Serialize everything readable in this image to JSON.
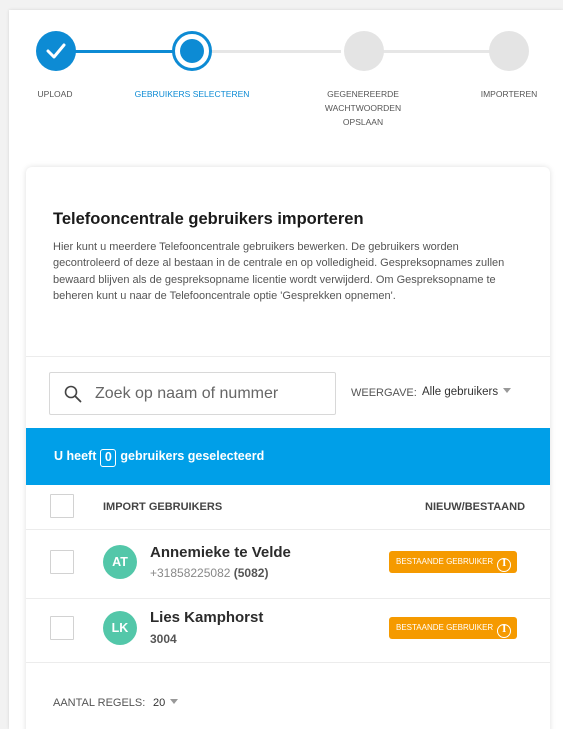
{
  "stepper": {
    "steps": [
      {
        "label": "UPLOAD",
        "state": "done"
      },
      {
        "label": "GEBRUIKERS SELECTEREN",
        "state": "current"
      },
      {
        "label": "GEGENEREERDE WACHTWOORDEN OPSLAAN",
        "state": "pending"
      },
      {
        "label": "IMPORTEREN",
        "state": "pending"
      }
    ]
  },
  "card": {
    "title": "Telefooncentrale gebruikers importeren",
    "description": "Hier kunt u meerdere Telefooncentrale gebruikers bewerken. De gebruikers worden gecontroleerd of deze al bestaan in de centrale en op volledigheid. Gespreksopnames zullen bewaard blijven als de gespreksopname licentie wordt verwijderd. Om Gespreksopname te beheren kunt u naar de Telefooncentrale optie 'Gesprekken opnemen'."
  },
  "search": {
    "placeholder": "Zoek op naam of nummer",
    "value": ""
  },
  "view": {
    "label": "WEERGAVE:",
    "value": "Alle gebruikers"
  },
  "selection": {
    "prefix": "U heeft",
    "count": "0",
    "suffix": "gebruikers geselecteerd"
  },
  "table": {
    "col_import": "IMPORT GEBRUIKERS",
    "col_status": "NIEUW/BESTAAND",
    "rows": [
      {
        "initials": "AT",
        "name": "Annemieke te Velde",
        "number": "+31858225082",
        "extension": "(5082)",
        "status": "BESTAANDE GEBRUIKER"
      },
      {
        "initials": "LK",
        "name": "Lies Kamphorst",
        "number": "",
        "extension": "3004",
        "status": "BESTAANDE GEBRUIKER"
      }
    ]
  },
  "footer": {
    "rows_label": "AANTAL REGELS:",
    "rows_value": "20"
  },
  "colors": {
    "primary": "#0d8bd4",
    "selection_bar": "#009fe8",
    "badge": "#f59a00",
    "avatar": "#53c7a9"
  },
  "icons": {
    "step_done": "check-icon",
    "search": "search-icon",
    "badge": "info-icon",
    "dropdown": "caret-down-icon"
  }
}
